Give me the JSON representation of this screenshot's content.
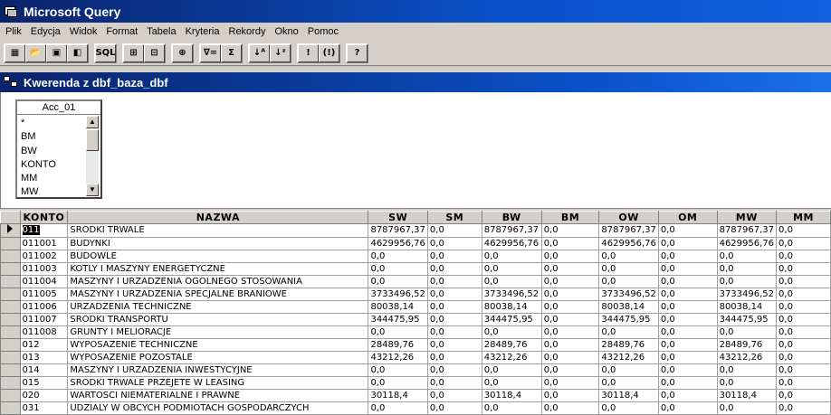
{
  "window": {
    "title": "Microsoft Query"
  },
  "menu": [
    "Plik",
    "Edycja",
    "Widok",
    "Format",
    "Tabela",
    "Kryteria",
    "Rekordy",
    "Okno",
    "Pomoc"
  ],
  "toolbar": {
    "sql_label": "SQL",
    "buttons": [
      "new-query-icon",
      "open-icon",
      "save-icon",
      "return-data-icon",
      "sql-icon",
      "show-tables-icon",
      "show-criteria-icon",
      "add-tables-icon",
      "criteria-equals-icon",
      "sum-icon",
      "sort-asc-icon",
      "sort-desc-icon",
      "query-now-icon",
      "auto-query-icon",
      "help-icon"
    ]
  },
  "query_window": {
    "title": "Kwerenda z dbf_baza_dbf"
  },
  "table_box": {
    "name": "Acc_01",
    "fields": [
      "*",
      "BM",
      "BW",
      "KONTO",
      "MM",
      "MW"
    ]
  },
  "grid": {
    "columns": [
      "KONTO",
      "NAZWA",
      "SW",
      "SM",
      "BW",
      "BM",
      "OW",
      "OM",
      "MW",
      "MM"
    ],
    "rows": [
      [
        "011",
        "SRODKI TRWALE",
        "8787967,37",
        "0,0",
        "8787967,37",
        "0,0",
        "8787967,37",
        "0,0",
        "8787967,37",
        "0,0"
      ],
      [
        "011001",
        "BUDYNKI",
        "4629956,76",
        "0,0",
        "4629956,76",
        "0,0",
        "4629956,76",
        "0,0",
        "4629956,76",
        "0,0"
      ],
      [
        "011002",
        "BUDOWLE",
        "0,0",
        "0,0",
        "0,0",
        "0,0",
        "0,0",
        "0,0",
        "0,0",
        "0,0"
      ],
      [
        "011003",
        "KOTLY I MASZYNY ENERGETYCZNE",
        "0,0",
        "0,0",
        "0,0",
        "0,0",
        "0,0",
        "0,0",
        "0,0",
        "0,0"
      ],
      [
        "011004",
        "MASZYNY I URZADZENIA OGOLNEGO STOSOWANIA",
        "0,0",
        "0,0",
        "0,0",
        "0,0",
        "0,0",
        "0,0",
        "0,0",
        "0,0"
      ],
      [
        "011005",
        "MASZYNY I URZADZENIA SPECJALNE BRANIOWE",
        "3733496,52",
        "0,0",
        "3733496,52",
        "0,0",
        "3733496,52",
        "0,0",
        "3733496,52",
        "0,0"
      ],
      [
        "011006",
        "URZADZENIA TECHNICZNE",
        "80038,14",
        "0,0",
        "80038,14",
        "0,0",
        "80038,14",
        "0,0",
        "80038,14",
        "0,0"
      ],
      [
        "011007",
        "SRODKI TRANSPORTU",
        "344475,95",
        "0,0",
        "344475,95",
        "0,0",
        "344475,95",
        "0,0",
        "344475,95",
        "0,0"
      ],
      [
        "011008",
        "GRUNTY I MELIORACJE",
        "0,0",
        "0,0",
        "0,0",
        "0,0",
        "0,0",
        "0,0",
        "0,0",
        "0,0"
      ],
      [
        "012",
        "WYPOSAZENIE TECHNICZNE",
        "28489,76",
        "0,0",
        "28489,76",
        "0,0",
        "28489,76",
        "0,0",
        "28489,76",
        "0,0"
      ],
      [
        "013",
        "WYPOSAZENIE POZOSTALE",
        "43212,26",
        "0,0",
        "43212,26",
        "0,0",
        "43212,26",
        "0,0",
        "43212,26",
        "0,0"
      ],
      [
        "014",
        "MASZYNY I URZADZENIA INWESTYCYJNE",
        "0,0",
        "0,0",
        "0,0",
        "0,0",
        "0,0",
        "0,0",
        "0,0",
        "0,0"
      ],
      [
        "015",
        "SRODKI TRWALE PRZEJETE W LEASING",
        "0,0",
        "0,0",
        "0,0",
        "0,0",
        "0,0",
        "0,0",
        "0,0",
        "0,0"
      ],
      [
        "020",
        "WARTOSCI NIEMATERIALNE I PRAWNE",
        "30118,4",
        "0,0",
        "30118,4",
        "0,0",
        "30118,4",
        "0,0",
        "30118,4",
        "0,0"
      ],
      [
        "031",
        "UDZIALY W OBCYCH PODMIOTACH GOSPODARCZYCH",
        "0,0",
        "0,0",
        "0,0",
        "0,0",
        "0,0",
        "0,0",
        "0,0",
        "0,0"
      ]
    ]
  }
}
